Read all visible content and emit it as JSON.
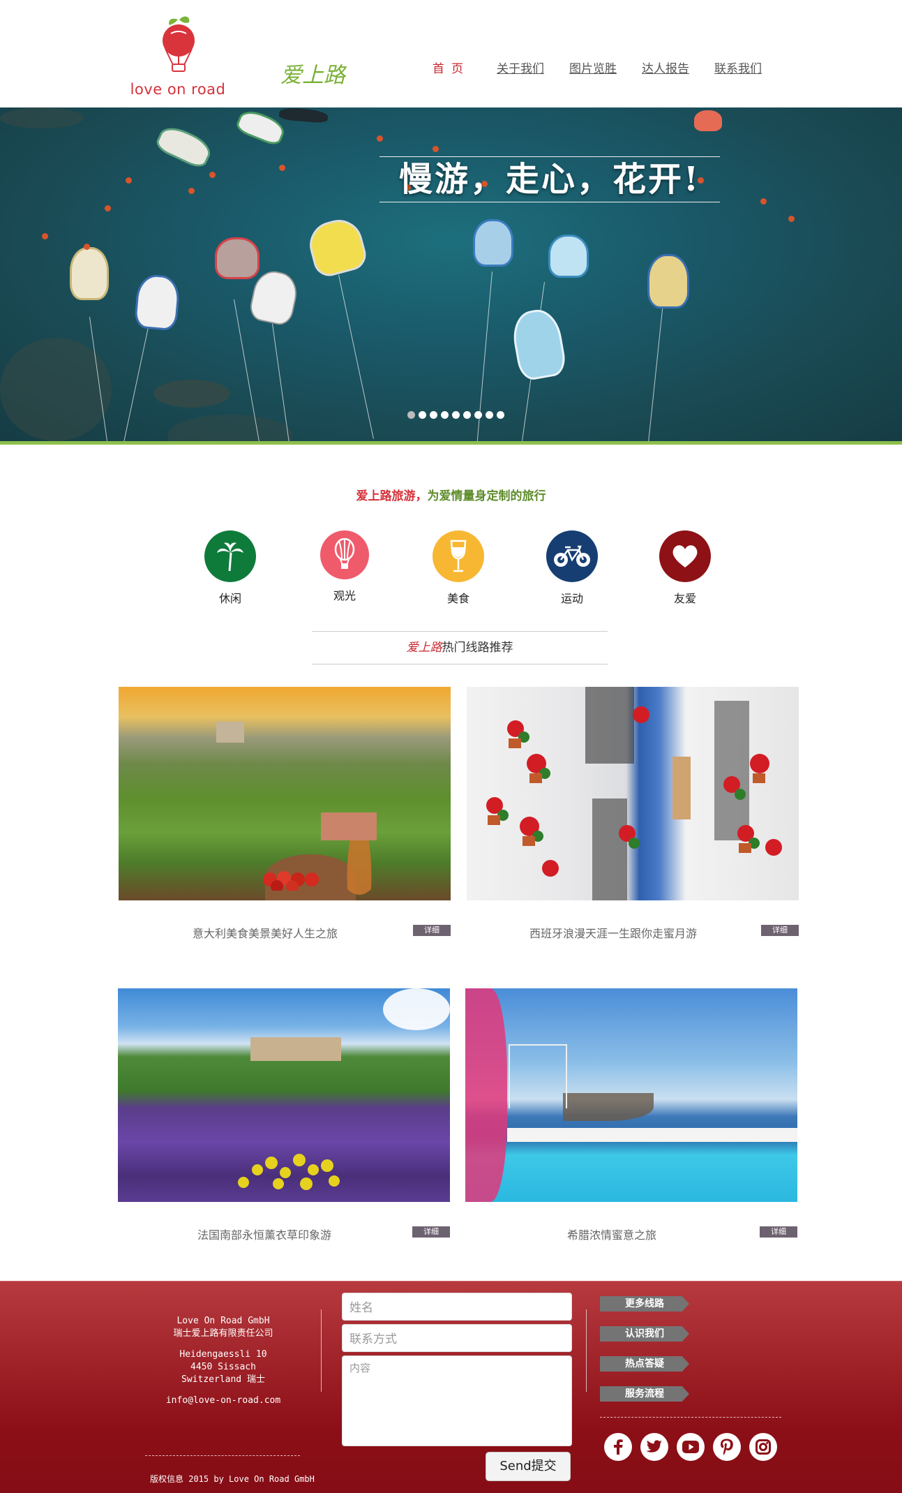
{
  "header": {
    "logo_text": "love on road",
    "brand_script": "爱上路",
    "nav": [
      "首页",
      "关于我们",
      "图片览胜",
      "达人报告",
      "联系我们"
    ]
  },
  "hero": {
    "slogan": "慢游，走心，花开!",
    "slide_count": 9,
    "active_slide": 1
  },
  "tagline": {
    "part1": "爱上路旅游，",
    "part2": "为爱情量身定制的旅行"
  },
  "categories": [
    {
      "label": "休闲",
      "icon": "palm-tree-icon",
      "color": "#0e7b3a"
    },
    {
      "label": "观光",
      "icon": "hot-air-balloon-icon",
      "color": "#ef5b6b"
    },
    {
      "label": "美食",
      "icon": "wine-glass-icon",
      "color": "#f7b733"
    },
    {
      "label": "运动",
      "icon": "bicycle-icon",
      "color": "#163e72"
    },
    {
      "label": "友爱",
      "icon": "heart-icon",
      "color": "#8e1116"
    }
  ],
  "section": {
    "brand": "爱上路",
    "title": "热门线路推荐"
  },
  "routes": [
    {
      "title": "意大利美食美景美好人生之旅",
      "button": "详细"
    },
    {
      "title": "西班牙浪漫天涯一生跟你走蜜月游",
      "button": "详细"
    },
    {
      "title": "法国南部永恒薰衣草印象游",
      "button": "详细"
    },
    {
      "title": "希腊浓情蜜意之旅",
      "button": "详细"
    }
  ],
  "footer": {
    "company_en": "Love On Road GmbH",
    "company_cn": "瑞士爱上路有限责任公司",
    "address1": "Heidengaessli 10",
    "address2": "4450 Sissach",
    "address3": "Switzerland 瑞士",
    "email": "info@love-on-road.com",
    "copyright": "版权信息 2015 by Love On Road GmbH",
    "form": {
      "name_placeholder": "姓名",
      "contact_placeholder": "联系方式",
      "content_placeholder": "内容",
      "send_label": "Send提交"
    },
    "links": [
      "更多线路",
      "认识我们",
      "热点答疑",
      "服务流程"
    ],
    "social": [
      "facebook-icon",
      "twitter-icon",
      "youtube-icon",
      "pinterest-icon",
      "instagram-icon"
    ]
  },
  "colors": {
    "brand_red": "#c9272e",
    "brand_green": "#7bb036",
    "footer_red": "#8c0f17",
    "detail_button": "#6d6270"
  }
}
